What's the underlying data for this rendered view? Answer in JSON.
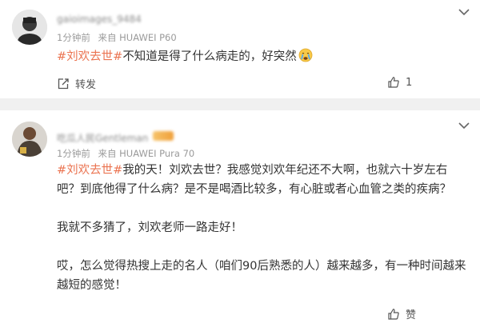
{
  "comments": [
    {
      "username": "gaioimages_9484",
      "time": "1分钟前",
      "source": "来自 HUAWEI P60",
      "hashtag": "#刘欢去世#",
      "text": "不知道是得了什么病走的，好突然",
      "emoji": "crying-emoji",
      "forward_label": "转发",
      "like_label": "1"
    },
    {
      "username": "吃瓜人民Gentleman",
      "time": "1分钟前",
      "source": "来自 HUAWEI Pura 70",
      "hashtag": "#刘欢去世#",
      "text_line1": "我的天！刘欢去世？我感觉刘欢年纪还不大啊，也就六十岁左右吧？到底他得了什么病？是不是喝酒比较多，有心脏或者心血管之类的疾病？",
      "text_para2": "我就不多猜了，刘欢老师一路走好！",
      "text_para3": "哎，怎么觉得热搜上走的名人（咱们90后熟悉的人）越来越多，有一种时间越来越短的感觉！",
      "like_label": "赞"
    }
  ],
  "colors": {
    "hashtag": "#eb7350",
    "separator": "#f0f0f0",
    "meta": "#9a9a9a"
  }
}
